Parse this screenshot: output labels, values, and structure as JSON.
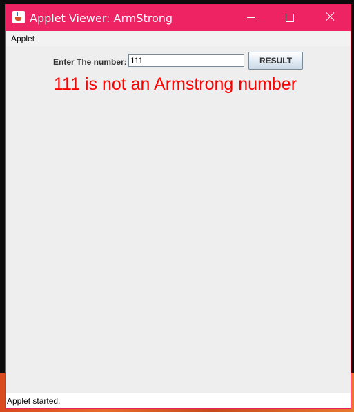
{
  "window": {
    "title": "Applet Viewer: ArmStrong",
    "frame_color": "#ee2364"
  },
  "menubar": {
    "items": [
      {
        "label": "Applet"
      }
    ]
  },
  "applet": {
    "input_label": "Enter The number:",
    "input_value": "111",
    "button_label": "RESULT",
    "result_message": "111 is not an Armstrong number",
    "result_color": "#ff0000"
  },
  "status": {
    "text": "Applet started."
  }
}
